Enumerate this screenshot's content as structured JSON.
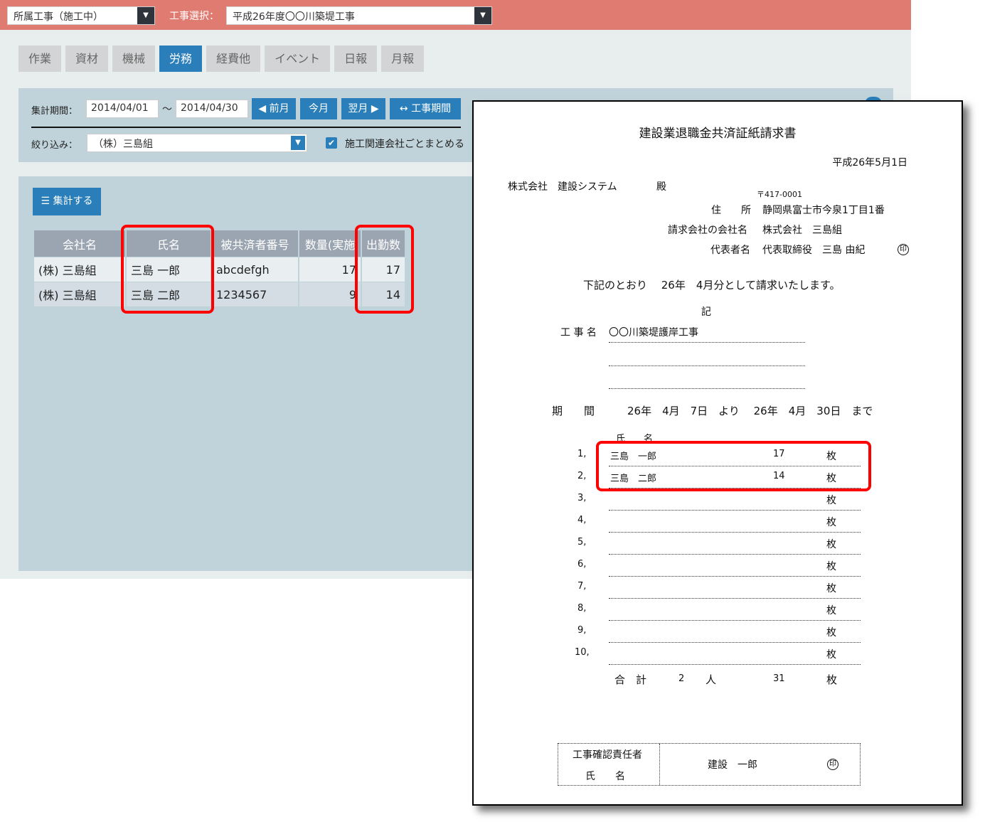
{
  "topbar": {
    "affiliation_select": "所属工事（施工中）",
    "project_label": "工事選択：",
    "project_select": "平成26年度〇〇川築堤工事",
    "dropdown_arrow": "▼"
  },
  "tabs": [
    {
      "label": "作業",
      "active": false
    },
    {
      "label": "資材",
      "active": false
    },
    {
      "label": "機械",
      "active": false
    },
    {
      "label": "労務",
      "active": true
    },
    {
      "label": "経費他",
      "active": false
    },
    {
      "label": "イベント",
      "active": false
    },
    {
      "label": "日報",
      "active": false
    },
    {
      "label": "月報",
      "active": false
    }
  ],
  "filters": {
    "period_label": "集計期間：",
    "date_from": "2014/04/01",
    "tilde": "～",
    "date_to": "2014/04/30",
    "prev_month": "◀ 前月",
    "this_month": "今月",
    "next_month": "翌月 ▶",
    "project_period": "↔ 工事期間",
    "narrow_label": "絞り込み：",
    "company_select": "（株）三島組",
    "group_checkbox_checked": true,
    "group_checkbox_label": "施工関連会社ごとまとめる",
    "check_glyph": "✔"
  },
  "results": {
    "aggregate_button": "☰ 集計する",
    "columns": [
      "会社名",
      "氏名",
      "被共済者番号",
      "数量(実施",
      "出勤数"
    ],
    "rows": [
      [
        "(株) 三島組",
        "三島 一郎",
        "abcdefgh",
        "17",
        "17"
      ],
      [
        "(株) 三島組",
        "三島 二郎",
        "1234567",
        "9",
        "14"
      ]
    ]
  },
  "highlight_color": "#ff0000",
  "accent_color": "#2a7fba",
  "document": {
    "title": "建設業退職金共済証紙請求書",
    "date": "平成26年5月1日",
    "addressee": "株式会社　建設システム",
    "honorific": "殿",
    "postal": "〒417-0001",
    "address_label": "住　　所",
    "address": "静岡県富士市今泉1丁目1番",
    "company_label": "請求会社の会社名",
    "company": "株式会社　三島組",
    "rep_label": "代表者名",
    "rep": "代表取締役　三島 由紀",
    "seal": "印",
    "statement": "下記のとおり　 26年　4月分として請求いたします。",
    "ki": "記",
    "project_label": "工 事 名",
    "project_name": "〇〇川築堤護岸工事",
    "period_label": "期　　間",
    "period_value": "26年　4月　7日　より　 26年　4月　30日　まで",
    "name_header": "氏　　名",
    "unit": "枚",
    "entries": [
      {
        "no": "1,",
        "name": "三島　一郎",
        "count": "17"
      },
      {
        "no": "2,",
        "name": "三島　二郎",
        "count": "14"
      },
      {
        "no": "3,",
        "name": "",
        "count": ""
      },
      {
        "no": "4,",
        "name": "",
        "count": ""
      },
      {
        "no": "5,",
        "name": "",
        "count": ""
      },
      {
        "no": "6,",
        "name": "",
        "count": ""
      },
      {
        "no": "7,",
        "name": "",
        "count": ""
      },
      {
        "no": "8,",
        "name": "",
        "count": ""
      },
      {
        "no": "9,",
        "name": "",
        "count": ""
      },
      {
        "no": "10,",
        "name": "",
        "count": ""
      }
    ],
    "total_label": "合　計",
    "total_people": "2",
    "people_unit": "人",
    "total_count": "31",
    "confirm_label_1": "工事確認責任者",
    "confirm_label_2": "氏　　名",
    "confirm_name": "建設　一郎"
  }
}
